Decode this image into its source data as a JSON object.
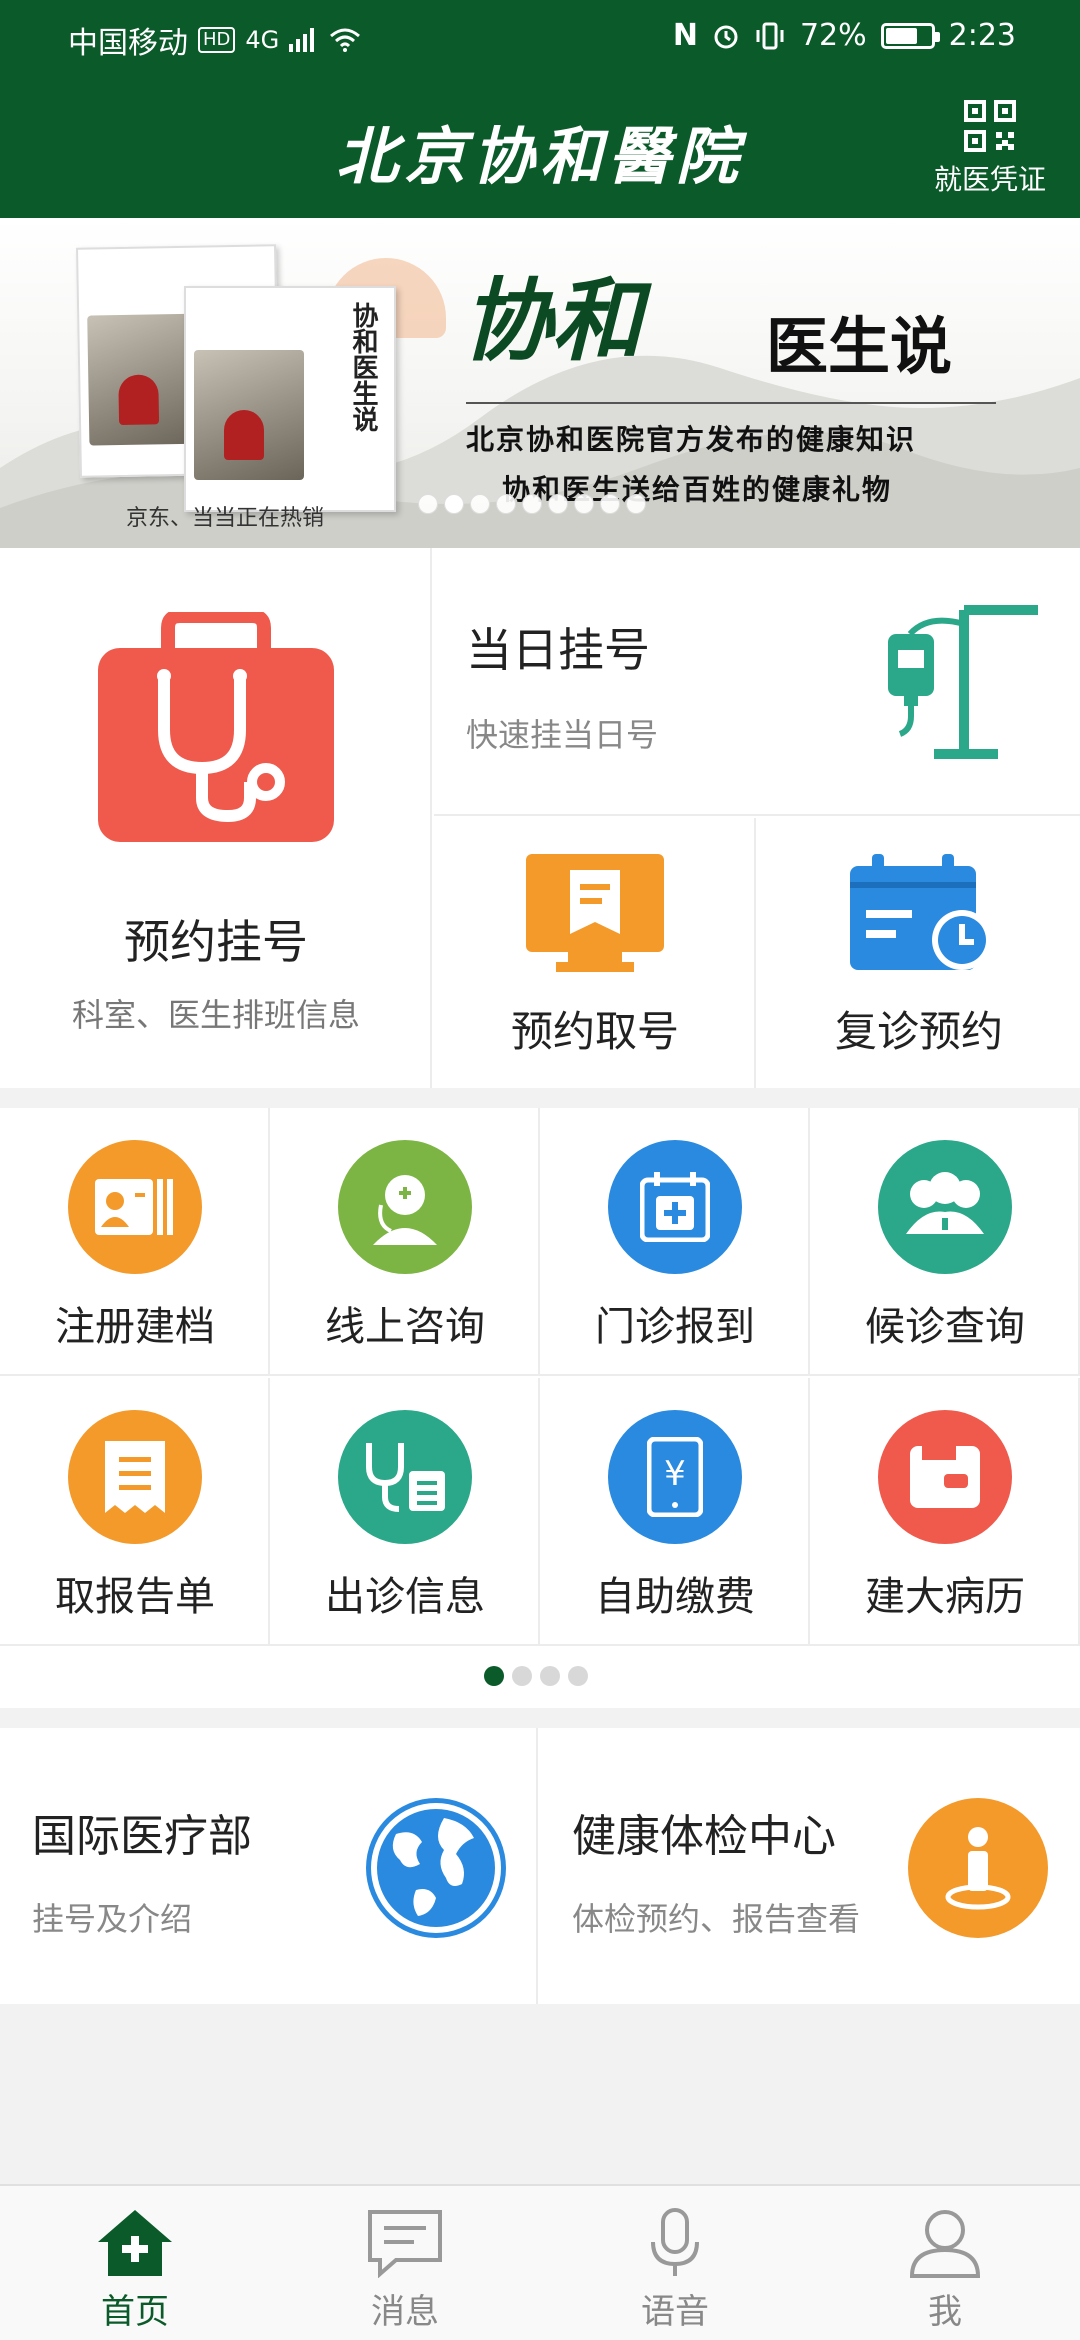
{
  "status_bar": {
    "carrier": "中国移动",
    "hd_badge": "HD",
    "network": "4G",
    "nfc": "N",
    "battery": "72%",
    "battery_level": 0.72,
    "time": "2:23"
  },
  "header": {
    "title": "北京协和醫院",
    "voucher_label": "就医凭证"
  },
  "banner": {
    "brand": "协和",
    "subtitle": "医生说",
    "line1": "北京协和医院官方发布的健康知识",
    "line2": "协和医生送给百姓的健康礼物",
    "caption": "京东、当当正在热销",
    "book_title": "协和医生说",
    "slide_count": 9,
    "active_slide": 1
  },
  "main": {
    "appointment": {
      "title": "预约挂号",
      "subtitle": "科室、医生排班信息"
    },
    "same_day": {
      "title": "当日挂号",
      "subtitle": "快速挂当日号"
    },
    "take_number": {
      "title": "预约取号"
    },
    "revisit": {
      "title": "复诊预约"
    }
  },
  "services": [
    {
      "label": "注册建档",
      "icon": "id-card-icon",
      "color": "#f39a2b"
    },
    {
      "label": "线上咨询",
      "icon": "doctor-icon",
      "color": "#7db544"
    },
    {
      "label": "门诊报到",
      "icon": "medical-calendar-icon",
      "color": "#2a8ae0"
    },
    {
      "label": "候诊查询",
      "icon": "people-group-icon",
      "color": "#2aa889"
    },
    {
      "label": "取报告单",
      "icon": "report-icon",
      "color": "#f39a2b"
    },
    {
      "label": "出诊信息",
      "icon": "stethoscope-list-icon",
      "color": "#2aa889"
    },
    {
      "label": "自助缴费",
      "icon": "yuan-phone-icon",
      "color": "#2a8ae0"
    },
    {
      "label": "建大病历",
      "icon": "wallet-icon",
      "color": "#ef5a4c"
    }
  ],
  "service_pages": {
    "count": 4,
    "active": 0
  },
  "cards": {
    "international": {
      "title": "国际医疗部",
      "subtitle": "挂号及介绍"
    },
    "checkup": {
      "title": "健康体检中心",
      "subtitle": "体检预约、报告查看"
    }
  },
  "nav": [
    {
      "label": "首页",
      "icon": "home-icon"
    },
    {
      "label": "消息",
      "icon": "message-icon"
    },
    {
      "label": "语音",
      "icon": "microphone-icon"
    },
    {
      "label": "我",
      "icon": "user-icon"
    }
  ],
  "colors": {
    "brand_green": "#0b5a2a",
    "appointment_red": "#ef5a4c",
    "same_day_teal": "#2aa889",
    "take_number_orange": "#f39a2b",
    "revisit_blue": "#2a8ae0"
  }
}
